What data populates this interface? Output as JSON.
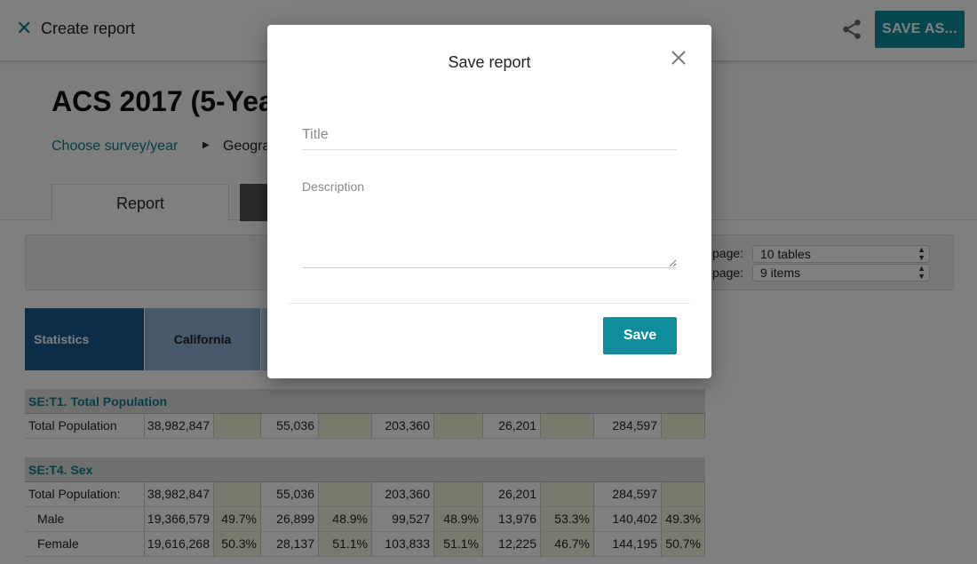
{
  "appbar": {
    "close_icon": "close-icon",
    "title": "Create report",
    "share_icon": "share-icon",
    "save_as_label": "SAVE AS..."
  },
  "header": {
    "report_title": "ACS 2017 (5-Yea",
    "breadcrumb": {
      "step1": "Choose survey/year",
      "caret": "▶",
      "step2": "Geogra"
    },
    "tabs": [
      {
        "label": "Report",
        "selected": true
      },
      {
        "label": "",
        "selected": false
      }
    ]
  },
  "toolbar": {
    "tables_label": "page:",
    "tables_value": "10 tables",
    "items_label": "page:",
    "items_value": "9 items"
  },
  "table": {
    "header": {
      "stats": "Statistics",
      "col1": "California"
    },
    "sections": [
      {
        "title": "SE:T1. Total Population",
        "rows": [
          {
            "label": "Total Population",
            "cells": [
              "38,982,847",
              "",
              "55,036",
              "",
              "203,360",
              "",
              "26,201",
              "",
              "284,597",
              ""
            ]
          }
        ]
      },
      {
        "title": "SE:T4. Sex",
        "rows": [
          {
            "label": "Total Population:",
            "cells": [
              "38,982,847",
              "",
              "55,036",
              "",
              "203,360",
              "",
              "26,201",
              "",
              "284,597",
              ""
            ]
          },
          {
            "label": "Male",
            "cells": [
              "19,366,579",
              "49.7%",
              "26,899",
              "48.9%",
              "99,527",
              "48.9%",
              "13,976",
              "53.3%",
              "140,402",
              "49.3%"
            ]
          },
          {
            "label": "Female",
            "cells": [
              "19,616,268",
              "50.3%",
              "28,137",
              "51.1%",
              "103,833",
              "51.1%",
              "12,225",
              "46.7%",
              "144,195",
              "50.7%"
            ]
          }
        ]
      }
    ]
  },
  "modal": {
    "title": "Save report",
    "close_icon": "close-icon",
    "title_placeholder": "Title",
    "title_value": "",
    "description_label": "Description",
    "description_value": "",
    "save_label": "Save"
  },
  "colors": {
    "accent": "#0f8d9c",
    "link": "#0f7d8c",
    "table_header_dark": "#1a5a8c",
    "table_header_light": "#8db0d4",
    "pct_cell_bg": "#f3f5dc"
  }
}
